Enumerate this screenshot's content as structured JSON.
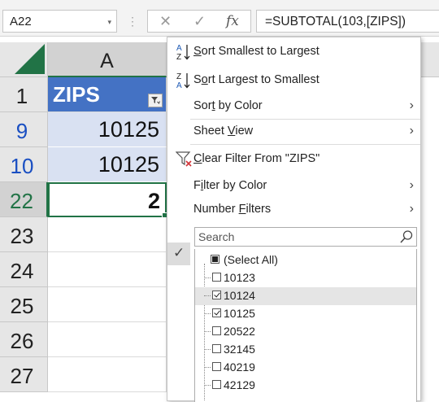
{
  "formula_bar": {
    "name_box": "A22",
    "name_box_arrow": "▾",
    "separator": "⋮",
    "cancel_glyph": "✕",
    "enter_glyph": "✓",
    "fx_glyph": "fx",
    "formula": "=SUBTOTAL(103,[ZIPS])"
  },
  "grid": {
    "column_header": "A",
    "rows": [
      {
        "num": "1",
        "value": "ZIPS",
        "kind": "header"
      },
      {
        "num": "9",
        "value": "10125",
        "kind": "data"
      },
      {
        "num": "10",
        "value": "10125",
        "kind": "data"
      },
      {
        "num": "22",
        "value": "2",
        "kind": "total"
      },
      {
        "num": "23",
        "value": ""
      },
      {
        "num": "24",
        "value": ""
      },
      {
        "num": "25",
        "value": ""
      },
      {
        "num": "26",
        "value": ""
      },
      {
        "num": "27",
        "value": ""
      }
    ]
  },
  "menu": {
    "sort_asc": {
      "pre": "",
      "key": "S",
      "post": "ort Smallest to Largest"
    },
    "sort_desc": {
      "pre": "S",
      "key": "o",
      "post": "rt Largest to Smallest"
    },
    "sort_by_color": {
      "pre": "Sor",
      "key": "t",
      "post": " by Color"
    },
    "sheet_view": {
      "pre": "Sheet ",
      "key": "V",
      "post": "iew"
    },
    "clear_filter": {
      "pre": "",
      "key": "C",
      "post": "lear Filter From \"ZIPS\""
    },
    "filter_by_color": {
      "pre": "F",
      "key": "i",
      "post": "lter by Color"
    },
    "number_filters": {
      "pre": "Number ",
      "key": "F",
      "post": "ilters"
    },
    "chevron": "›",
    "search_placeholder": "Search",
    "check_glyph": "✓",
    "list": [
      {
        "label": "(Select All)",
        "state": "partial"
      },
      {
        "label": "10123",
        "state": "unchecked"
      },
      {
        "label": "10124",
        "state": "checked"
      },
      {
        "label": "10125",
        "state": "checked"
      },
      {
        "label": "20522",
        "state": "unchecked"
      },
      {
        "label": "32145",
        "state": "unchecked"
      },
      {
        "label": "40219",
        "state": "unchecked"
      },
      {
        "label": "42129",
        "state": "unchecked"
      }
    ]
  },
  "colors": {
    "excel_green": "#217346",
    "table_header_blue": "#4472c4",
    "table_row_blue": "#d9e1f2",
    "row_number_blue": "#1a4fc2"
  }
}
